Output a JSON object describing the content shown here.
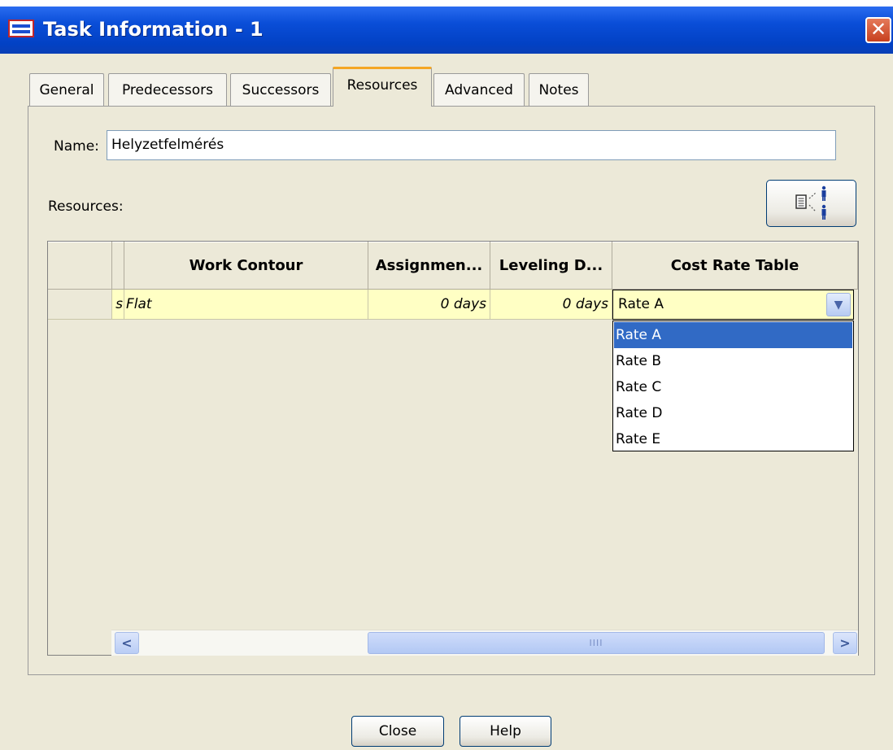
{
  "window": {
    "title": "Task Information - 1"
  },
  "tabs": [
    "General",
    "Predecessors",
    "Successors",
    "Resources",
    "Advanced",
    "Notes"
  ],
  "active_tab": "Resources",
  "form": {
    "name_label": "Name:",
    "name_value": "Helyzetfelmérés",
    "resources_label": "Resources:"
  },
  "table": {
    "columns": [
      "Work Contour",
      "Assignmen...",
      "Leveling D...",
      "Cost Rate Table"
    ],
    "row": {
      "prefix": "s",
      "work_contour": "Flat",
      "assignment_delay": "0 days",
      "leveling_delay": "0 days",
      "cost_rate_table": "Rate A"
    }
  },
  "dropdown": {
    "options": [
      "Rate A",
      "Rate B",
      "Rate C",
      "Rate D",
      "Rate E"
    ],
    "selected": "Rate A"
  },
  "scrollbar": {
    "left_arrow": "<",
    "right_arrow": ">",
    "grip": "IIII"
  },
  "buttons": {
    "close": "Close",
    "help": "Help"
  },
  "icons": {
    "title_app": "app-icon",
    "close": "close-icon",
    "assign_resources": "assign-resources-icon"
  },
  "colors": {
    "title_bar": "#0a4ed8",
    "selection": "#316AC5",
    "row_highlight": "#ffffc4",
    "active_tab_accent": "#f5a623",
    "dialog_bg": "#ECE9D8"
  }
}
